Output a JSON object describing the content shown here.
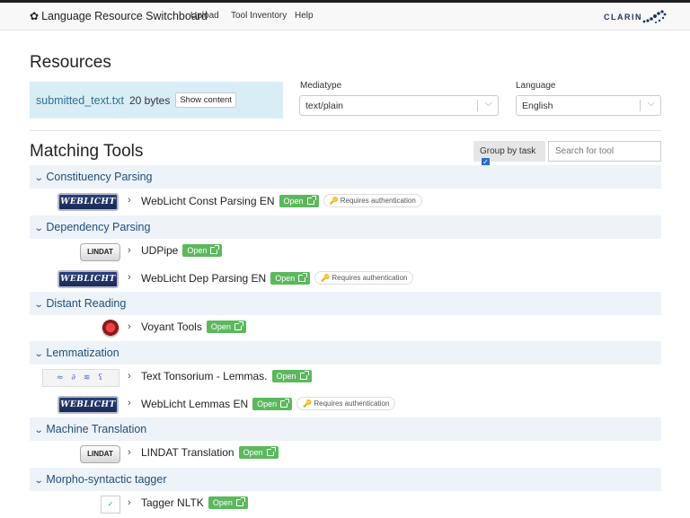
{
  "header": {
    "brand": "Language Resource Switchboard",
    "nav": [
      "Upload",
      "Tool Inventory",
      "Help"
    ],
    "clarin_logo": "CLARIN"
  },
  "resources": {
    "title": "Resources",
    "file_name": "submitted_text.txt",
    "file_size": "20 bytes",
    "show_content": "Show content",
    "mediatype_label": "Mediatype",
    "mediatype_value": "text/plain",
    "language_label": "Language",
    "language_value": "English"
  },
  "matching": {
    "title": "Matching Tools",
    "group_by_task": "Group by task",
    "group_by_checked": true,
    "search_placeholder": "Search for tool"
  },
  "labels": {
    "open": "Open",
    "requires_auth": "Requires authentication"
  },
  "categories": [
    {
      "name": "Constituency Parsing",
      "tools": [
        {
          "name": "WebLicht Const Parsing EN",
          "logo": "WebLicht",
          "auth": true
        }
      ]
    },
    {
      "name": "Dependency Parsing",
      "tools": [
        {
          "name": "UDPipe",
          "logo": "LINDAT",
          "auth": false
        },
        {
          "name": "WebLicht Dep Parsing EN",
          "logo": "WebLicht",
          "auth": true
        }
      ]
    },
    {
      "name": "Distant Reading",
      "tools": [
        {
          "name": "Voyant Tools",
          "logo": "voyant",
          "auth": false
        }
      ]
    },
    {
      "name": "Lemmatization",
      "tools": [
        {
          "name": "Text Tonsorium - Lemmas.",
          "logo": "tonsorium",
          "auth": false
        },
        {
          "name": "WebLicht Lemmas EN",
          "logo": "WebLicht",
          "auth": true
        }
      ]
    },
    {
      "name": "Machine Translation",
      "tools": [
        {
          "name": "LINDAT Translation",
          "logo": "LINDAT",
          "auth": false
        }
      ]
    },
    {
      "name": "Morpho-syntactic tagger",
      "tools": [
        {
          "name": "Tagger NLTK",
          "logo": "tagger",
          "auth": false
        }
      ]
    }
  ],
  "colors": {
    "category_bg": "#eef3f9",
    "category_text": "#1f4e79",
    "open_button": "#5cb85c",
    "resource_box": "#d9edf7"
  }
}
